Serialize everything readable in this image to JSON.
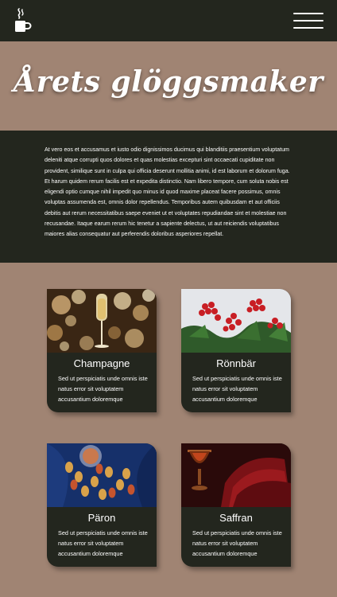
{
  "header": {
    "logo_icon": "mug-steam-icon",
    "menu_icon": "hamburger-menu-icon"
  },
  "hero": {
    "title": "Årets glöggsmaker"
  },
  "intro": {
    "text": "At vero eos et accusamus et iusto odio dignissimos ducimus qui blanditiis praesentium voluptatum deleniti atque corrupti quos dolores et quas molestias excepturi sint occaecati cupiditate non provident, similique sunt in culpa qui officia deserunt mollitia animi, id est laborum et dolorum fuga. Et harum quidem rerum facilis est et expedita distinctio. Nam libero tempore, cum soluta nobis est eligendi optio cumque nihil impedit quo minus id quod maxime placeat facere possimus, omnis voluptas assumenda est, omnis dolor repellendus. Temporibus autem quibusdam et aut officiis debitis aut rerum necessitatibus saepe eveniet ut et voluptates repudiandae sint et molestiae non recusandae. Itaque earum rerum hic tenetur a sapiente delectus, ut aut reiciendis voluptatibus maiores alias consequatur aut perferendis doloribus asperiores repellat."
  },
  "cards": [
    {
      "title": "Champagne",
      "text": "Sed ut perspiciatis unde omnis iste natus error sit voluptatem accusantium doloremque",
      "image": "champagne-glass-photo"
    },
    {
      "title": "Rönnbär",
      "text": "Sed ut perspiciatis unde omnis iste natus error sit voluptatem accusantium doloremque",
      "image": "rowan-berries-photo"
    },
    {
      "title": "Päron",
      "text": "Sed ut perspiciatis unde omnis iste natus error sit voluptatem accusantium doloremque",
      "image": "pears-photo"
    },
    {
      "title": "Saffran",
      "text": "Sed ut perspiciatis unde omnis iste natus error sit voluptatem accusantium doloremque",
      "image": "saffron-photo"
    }
  ],
  "colors": {
    "background": "#a08473",
    "dark": "#23261e",
    "text": "#ffffff"
  }
}
